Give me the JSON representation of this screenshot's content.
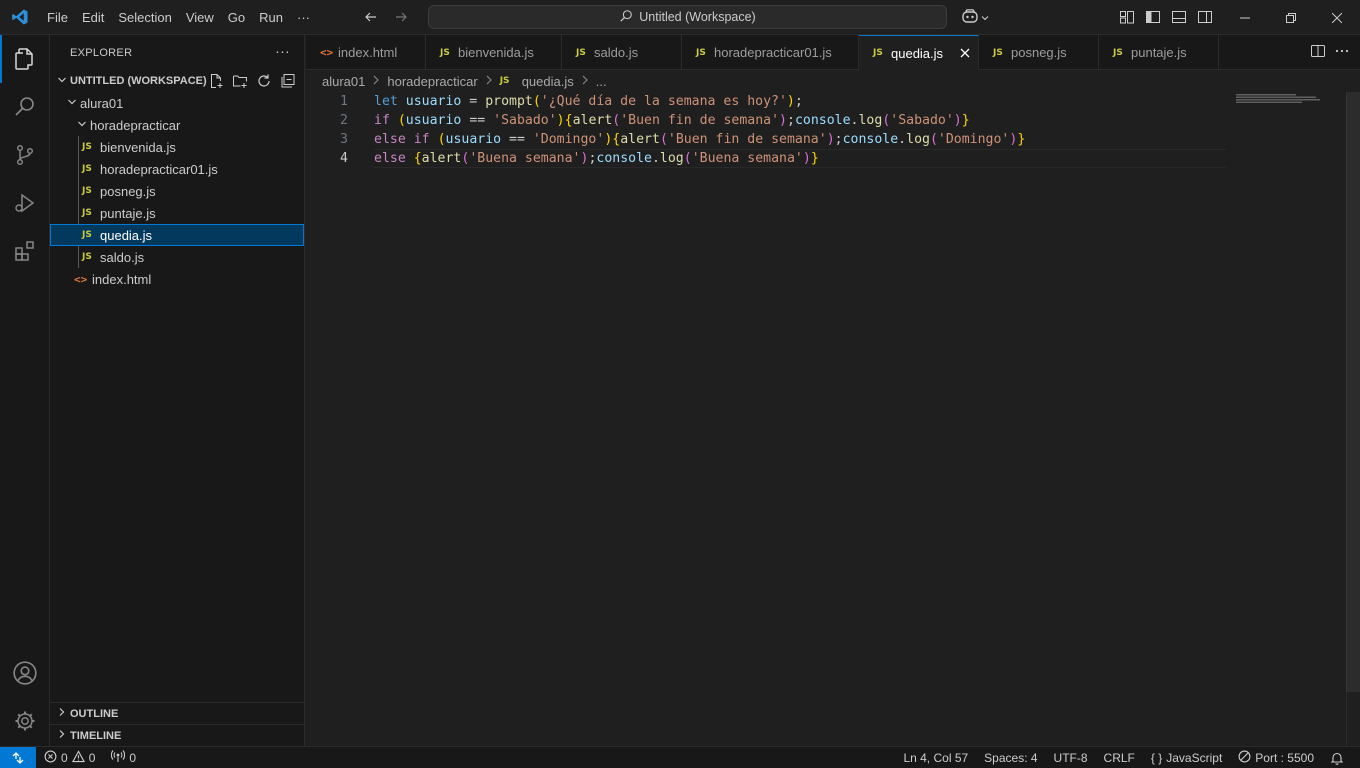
{
  "titlebar": {
    "menu": [
      "File",
      "Edit",
      "Selection",
      "View",
      "Go",
      "Run",
      "···"
    ],
    "command_center": "Untitled (Workspace)",
    "accent": "#0078d4"
  },
  "sidebar": {
    "title": "EXPLORER",
    "more": "···",
    "workspace": "UNTITLED (WORKSPACE)",
    "tree": {
      "root": "alura01",
      "folder": "horadepracticar",
      "files": [
        {
          "name": "bienvenida.js",
          "type": "JS"
        },
        {
          "name": "horadepracticar01.js",
          "type": "JS"
        },
        {
          "name": "posneg.js",
          "type": "JS"
        },
        {
          "name": "puntaje.js",
          "type": "JS"
        },
        {
          "name": "quedia.js",
          "type": "JS"
        },
        {
          "name": "saldo.js",
          "type": "JS"
        }
      ],
      "root_file": {
        "name": "index.html",
        "type": "<>"
      }
    },
    "outline": "OUTLINE",
    "timeline": "TIMELINE"
  },
  "tabs": [
    {
      "label": "index.html",
      "icon": "<>"
    },
    {
      "label": "bienvenida.js",
      "icon": "JS"
    },
    {
      "label": "saldo.js",
      "icon": "JS"
    },
    {
      "label": "horadepracticar01.js",
      "icon": "JS"
    },
    {
      "label": "quedia.js",
      "icon": "JS"
    },
    {
      "label": "posneg.js",
      "icon": "JS"
    },
    {
      "label": "puntaje.js",
      "icon": "JS"
    }
  ],
  "breadcrumb": {
    "parts": [
      "alura01",
      "horadepracticar",
      "quedia.js",
      "..."
    ],
    "file_icon": "JS"
  },
  "editor": {
    "line_numbers": [
      "1",
      "2",
      "3",
      "4"
    ],
    "lines": [
      [
        [
          "kw",
          "let"
        ],
        [
          "pun",
          " "
        ],
        [
          "var",
          "usuario"
        ],
        [
          "pun",
          " = "
        ],
        [
          "fn",
          "prompt"
        ],
        [
          "br1",
          "("
        ],
        [
          "str",
          "'¿Qué día de la semana es hoy?'"
        ],
        [
          "br1",
          ")"
        ],
        [
          "pun",
          ";"
        ]
      ],
      [
        [
          "ctl",
          "if"
        ],
        [
          "pun",
          " "
        ],
        [
          "br1",
          "("
        ],
        [
          "var",
          "usuario"
        ],
        [
          "pun",
          " == "
        ],
        [
          "str",
          "'Sabado'"
        ],
        [
          "br1",
          ")"
        ],
        [
          "br1",
          "{"
        ],
        [
          "fn",
          "alert"
        ],
        [
          "br2",
          "("
        ],
        [
          "str",
          "'Buen fin de semana'"
        ],
        [
          "br2",
          ")"
        ],
        [
          "pun",
          ";"
        ],
        [
          "var",
          "console"
        ],
        [
          "pun",
          "."
        ],
        [
          "fn",
          "log"
        ],
        [
          "br2",
          "("
        ],
        [
          "str",
          "'Sabado'"
        ],
        [
          "br2",
          ")"
        ],
        [
          "br1",
          "}"
        ]
      ],
      [
        [
          "ctl",
          "else"
        ],
        [
          "pun",
          " "
        ],
        [
          "ctl",
          "if"
        ],
        [
          "pun",
          " "
        ],
        [
          "br1",
          "("
        ],
        [
          "var",
          "usuario"
        ],
        [
          "pun",
          " == "
        ],
        [
          "str",
          "'Domingo'"
        ],
        [
          "br1",
          ")"
        ],
        [
          "br1",
          "{"
        ],
        [
          "fn",
          "alert"
        ],
        [
          "br2",
          "("
        ],
        [
          "str",
          "'Buen fin de semana'"
        ],
        [
          "br2",
          ")"
        ],
        [
          "pun",
          ";"
        ],
        [
          "var",
          "console"
        ],
        [
          "pun",
          "."
        ],
        [
          "fn",
          "log"
        ],
        [
          "br2",
          "("
        ],
        [
          "str",
          "'Domingo'"
        ],
        [
          "br2",
          ")"
        ],
        [
          "br1",
          "}"
        ]
      ],
      [
        [
          "ctl",
          "else"
        ],
        [
          "pun",
          " "
        ],
        [
          "br1",
          "{"
        ],
        [
          "fn",
          "alert"
        ],
        [
          "br2",
          "("
        ],
        [
          "str",
          "'Buena semana'"
        ],
        [
          "br2",
          ")"
        ],
        [
          "pun",
          ";"
        ],
        [
          "var",
          "console"
        ],
        [
          "pun",
          "."
        ],
        [
          "fn",
          "log"
        ],
        [
          "br2",
          "("
        ],
        [
          "str",
          "'Buena semana'"
        ],
        [
          "br2",
          ")"
        ],
        [
          "br1",
          "}"
        ]
      ]
    ]
  },
  "statusbar": {
    "errors": "0",
    "warnings": "0",
    "ports": "0",
    "position": "Ln 4, Col 57",
    "spaces": "Spaces: 4",
    "encoding": "UTF-8",
    "eol": "CRLF",
    "language_brace": "{ }",
    "language": "JavaScript",
    "port": "Port : 5500"
  }
}
